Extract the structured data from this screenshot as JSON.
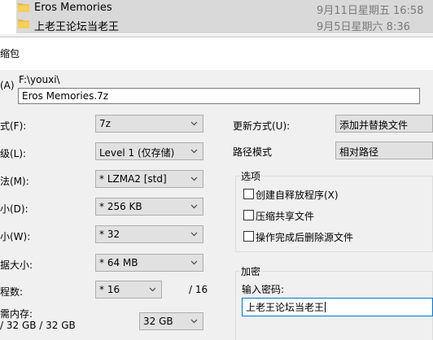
{
  "explorer": {
    "files": [
      {
        "name": "Eros Memories",
        "date": "9月11日星期五 16:58"
      },
      {
        "name": "上老王论坛当老王",
        "date": "9月5日星期六 8:36"
      }
    ]
  },
  "dialog": {
    "title": "缩包",
    "archive": {
      "label": "(A)",
      "path": "F:\\youxi\\",
      "filename": "Eros Memories.7z"
    },
    "format": {
      "label": "式(F):",
      "value": "7z"
    },
    "level": {
      "label": "级(L):",
      "value": "Level 1 (仅存储)"
    },
    "method": {
      "label": "法(M):",
      "value": "* LZMA2 [std]"
    },
    "dict": {
      "label": "小(D):",
      "value": "* 256 KB"
    },
    "word": {
      "label": "小(W):",
      "value": "* 32"
    },
    "solid": {
      "label": "据大小:",
      "value": "* 64 MB"
    },
    "threads": {
      "label": "程数:",
      "value": "* 16",
      "max": "/ 16"
    },
    "memory": {
      "label": "需内存:",
      "usage": "/ 32 GB / 32 GB",
      "value": "32 GB"
    },
    "update": {
      "label": "更新方式(U):",
      "value": "添加并替换文件"
    },
    "pathmode": {
      "label": "路径模式",
      "value": "相对路径"
    },
    "options": {
      "title": "选项",
      "items": [
        "创建自释放程序(X)",
        "压缩共享文件",
        "操作完成后删除源文件"
      ]
    },
    "encryption": {
      "title": "加密",
      "password_label": "输入密码:",
      "password_value": "上老王论坛当老王"
    }
  }
}
